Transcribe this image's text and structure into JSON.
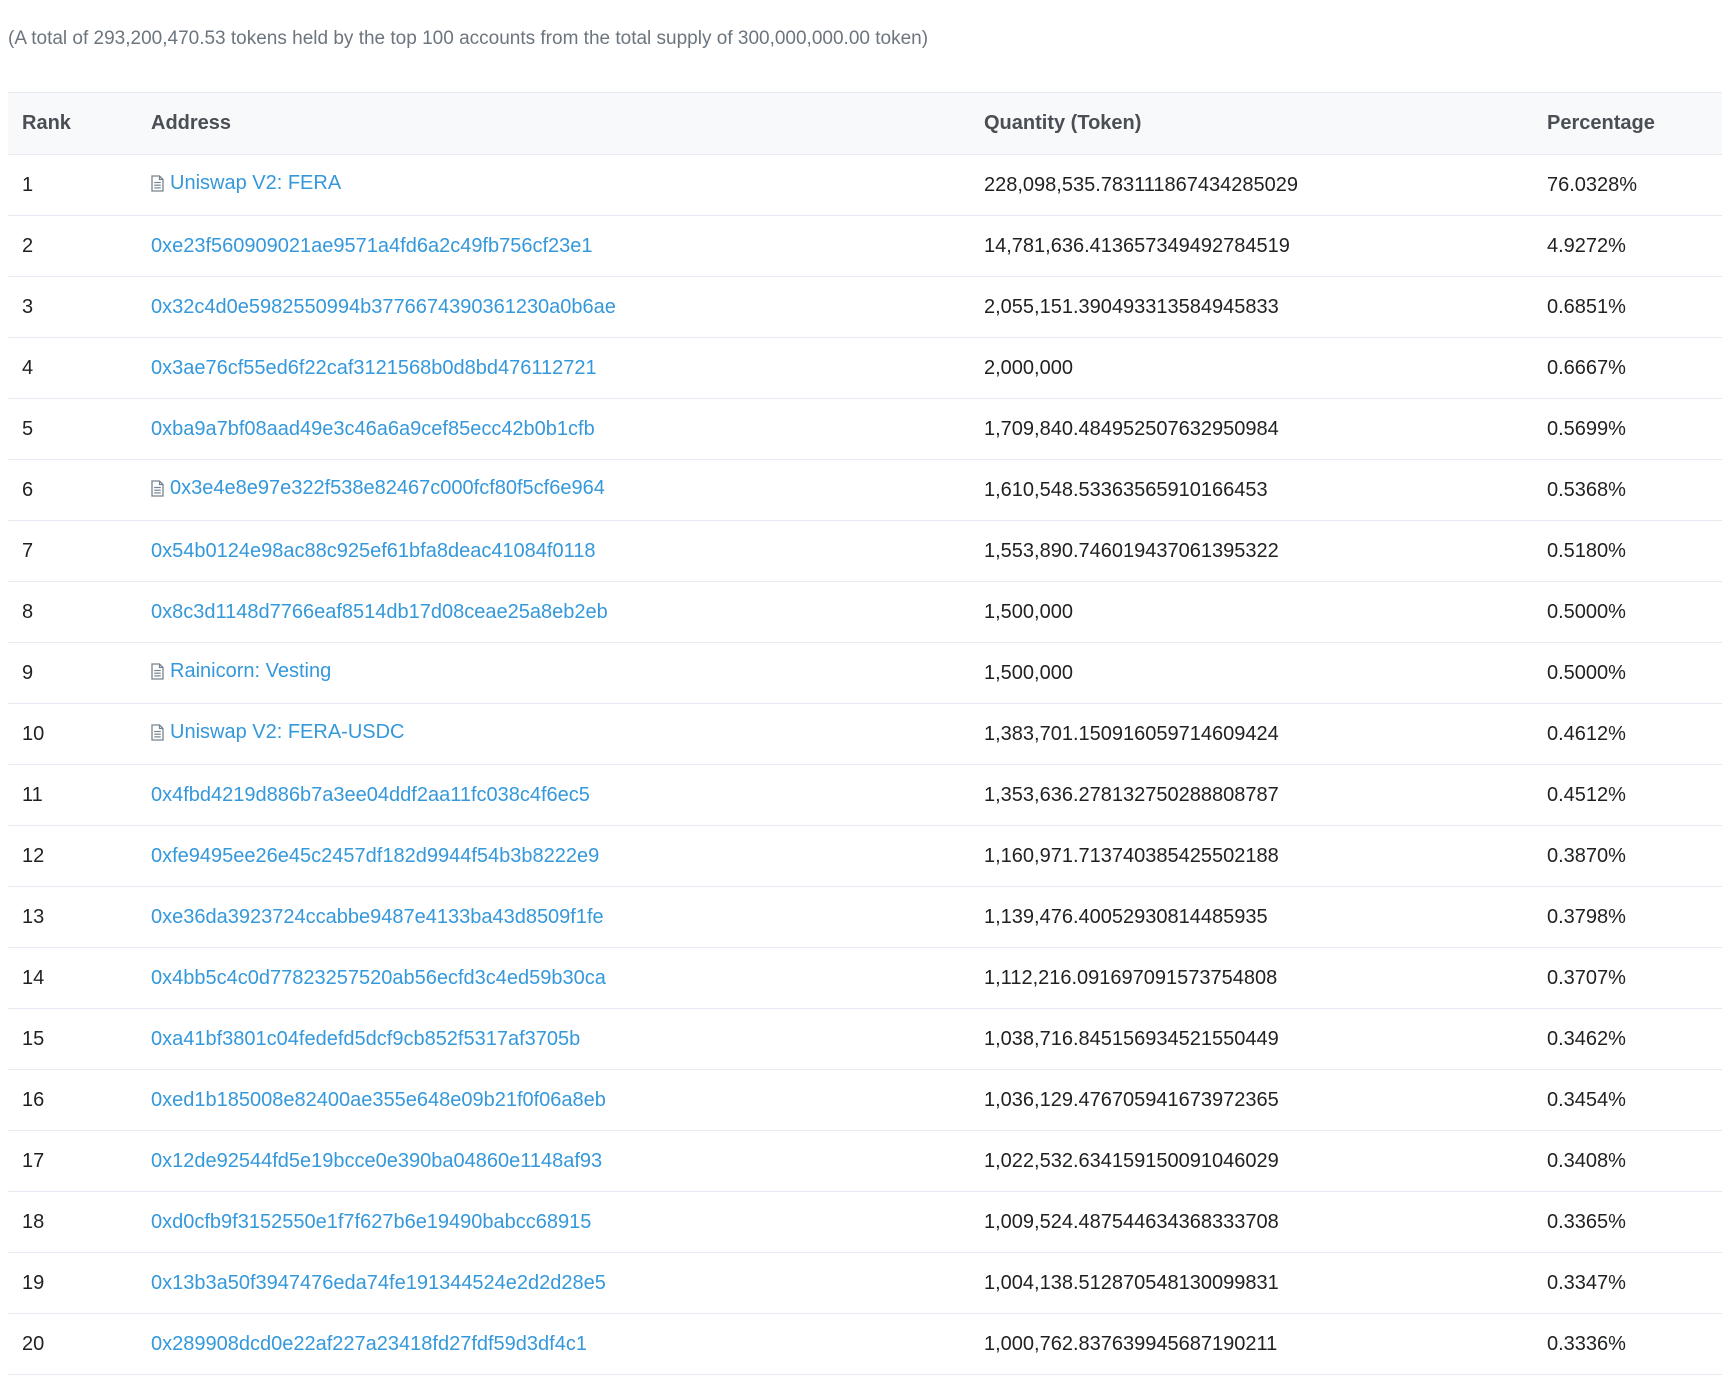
{
  "summary": "(A total of 293,200,470.53 tokens held by the top 100 accounts from the total supply of 300,000,000.00 token)",
  "table": {
    "headers": {
      "rank": "Rank",
      "address": "Address",
      "quantity": "Quantity (Token)",
      "percentage": "Percentage"
    },
    "rows": [
      {
        "rank": "1",
        "address": "Uniswap V2: FERA",
        "contract": true,
        "quantity": "228,098,535.783111867434285029",
        "percentage": "76.0328%"
      },
      {
        "rank": "2",
        "address": "0xe23f560909021ae9571a4fd6a2c49fb756cf23e1",
        "contract": false,
        "quantity": "14,781,636.413657349492784519",
        "percentage": "4.9272%"
      },
      {
        "rank": "3",
        "address": "0x32c4d0e5982550994b3776674390361230a0b6ae",
        "contract": false,
        "quantity": "2,055,151.390493313584945833",
        "percentage": "0.6851%"
      },
      {
        "rank": "4",
        "address": "0x3ae76cf55ed6f22caf3121568b0d8bd476112721",
        "contract": false,
        "quantity": "2,000,000",
        "percentage": "0.6667%"
      },
      {
        "rank": "5",
        "address": "0xba9a7bf08aad49e3c46a6a9cef85ecc42b0b1cfb",
        "contract": false,
        "quantity": "1,709,840.484952507632950984",
        "percentage": "0.5699%"
      },
      {
        "rank": "6",
        "address": "0x3e4e8e97e322f538e82467c000fcf80f5cf6e964",
        "contract": true,
        "quantity": "1,610,548.53363565910166453",
        "percentage": "0.5368%"
      },
      {
        "rank": "7",
        "address": "0x54b0124e98ac88c925ef61bfa8deac41084f0118",
        "contract": false,
        "quantity": "1,553,890.746019437061395322",
        "percentage": "0.5180%"
      },
      {
        "rank": "8",
        "address": "0x8c3d1148d7766eaf8514db17d08ceae25a8eb2eb",
        "contract": false,
        "quantity": "1,500,000",
        "percentage": "0.5000%"
      },
      {
        "rank": "9",
        "address": "Rainicorn: Vesting",
        "contract": true,
        "quantity": "1,500,000",
        "percentage": "0.5000%"
      },
      {
        "rank": "10",
        "address": "Uniswap V2: FERA-USDC",
        "contract": true,
        "quantity": "1,383,701.150916059714609424",
        "percentage": "0.4612%"
      },
      {
        "rank": "11",
        "address": "0x4fbd4219d886b7a3ee04ddf2aa11fc038c4f6ec5",
        "contract": false,
        "quantity": "1,353,636.278132750288808787",
        "percentage": "0.4512%"
      },
      {
        "rank": "12",
        "address": "0xfe9495ee26e45c2457df182d9944f54b3b8222e9",
        "contract": false,
        "quantity": "1,160,971.713740385425502188",
        "percentage": "0.3870%"
      },
      {
        "rank": "13",
        "address": "0xe36da3923724ccabbe9487e4133ba43d8509f1fe",
        "contract": false,
        "quantity": "1,139,476.40052930814485935",
        "percentage": "0.3798%"
      },
      {
        "rank": "14",
        "address": "0x4bb5c4c0d77823257520ab56ecfd3c4ed59b30ca",
        "contract": false,
        "quantity": "1,112,216.091697091573754808",
        "percentage": "0.3707%"
      },
      {
        "rank": "15",
        "address": "0xa41bf3801c04fedefd5dcf9cb852f5317af3705b",
        "contract": false,
        "quantity": "1,038,716.845156934521550449",
        "percentage": "0.3462%"
      },
      {
        "rank": "16",
        "address": "0xed1b185008e82400ae355e648e09b21f0f06a8eb",
        "contract": false,
        "quantity": "1,036,129.476705941673972365",
        "percentage": "0.3454%"
      },
      {
        "rank": "17",
        "address": "0x12de92544fd5e19bcce0e390ba04860e1148af93",
        "contract": false,
        "quantity": "1,022,532.634159150091046029",
        "percentage": "0.3408%"
      },
      {
        "rank": "18",
        "address": "0xd0cfb9f3152550e1f7f627b6e19490babcc68915",
        "contract": false,
        "quantity": "1,009,524.487544634368333708",
        "percentage": "0.3365%"
      },
      {
        "rank": "19",
        "address": "0x13b3a50f3947476eda74fe191344524e2d2d28e5",
        "contract": false,
        "quantity": "1,004,138.512870548130099831",
        "percentage": "0.3347%"
      },
      {
        "rank": "20",
        "address": "0x289908dcd0e22af227a23418fd27fdf59d3df4c1",
        "contract": false,
        "quantity": "1,000,762.837639945687190211",
        "percentage": "0.3336%"
      }
    ]
  },
  "icons": {
    "contract": "document-icon"
  },
  "colors": {
    "link": "#3498db",
    "summary_text": "#6c757e",
    "header_bg": "#f8f9fa",
    "row_border": "#e7eaf3"
  }
}
